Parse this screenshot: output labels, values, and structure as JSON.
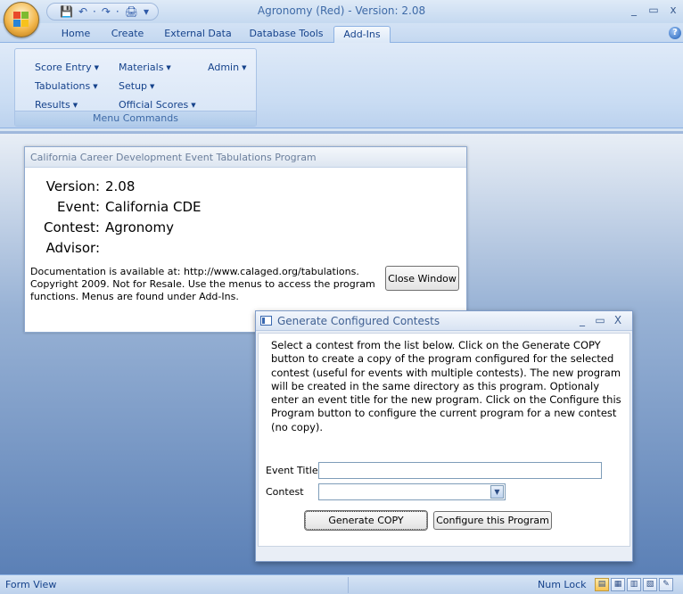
{
  "window": {
    "title": "Agronomy (Red) - Version: 2.08",
    "controls": [
      "_",
      "▭",
      "x"
    ]
  },
  "quick_access": {
    "icons": [
      "save-icon",
      "undo-icon",
      "redo-icon",
      "print-icon",
      "customize-icon"
    ],
    "glyphs": [
      "💾",
      "↶",
      "·",
      "↷",
      "·",
      "🖨",
      "▾"
    ]
  },
  "tabs": [
    {
      "label": "Home",
      "active": false
    },
    {
      "label": "Create",
      "active": false
    },
    {
      "label": "External Data",
      "active": false
    },
    {
      "label": "Database Tools",
      "active": false
    },
    {
      "label": "Add-Ins",
      "active": true
    }
  ],
  "help_glyph": "?",
  "ribbon": {
    "group_label": "Menu Commands",
    "commands": [
      {
        "label": "Score Entry"
      },
      {
        "label": "Materials"
      },
      {
        "label": "Admin"
      },
      {
        "label": "Tabulations"
      },
      {
        "label": "Setup"
      },
      {
        "label": "Results"
      },
      {
        "label": "Official Scores"
      }
    ]
  },
  "main_form": {
    "title": "California Career Development Event Tabulations Program",
    "version_label": "Version:",
    "version_value": "2.08",
    "event_label": "Event:",
    "event_value": "California CDE",
    "contest_label": "Contest:",
    "contest_value": "Agronomy",
    "advisor_label": "Advisor:",
    "advisor_value": "",
    "documentation": "Documentation is available at: http://www.calaged.org/tabulations. Copyright 2009. Not for Resale. Use the menus to access the program functions.   Menus are found under Add-Ins.",
    "close_button": "Close Window"
  },
  "dialog": {
    "title": "Generate Configured Contests",
    "controls": [
      "_",
      "▭",
      "X"
    ],
    "instructions": "Select a contest from the list below.  Click on the Generate COPY button to create a copy of the program configured for the selected contest (useful for events with multiple contests). The new program will be created in the same directory as this program.  Optionaly enter an event title for the new program. Click on the Configure this Program button to configure the current program for a new contest (no copy).",
    "event_title_label": "Event Title",
    "event_title_value": "",
    "contest_label": "Contest",
    "contest_value": "",
    "generate_button": "Generate COPY",
    "configure_button": "Configure this Program"
  },
  "statusbar": {
    "left": "Form View",
    "numlock": "Num Lock"
  },
  "colors": {
    "ribbon_text": "#15428b",
    "workspace_top": "#e8eef6",
    "workspace_bottom": "#5b80b6",
    "office_orb": "#f2b64b"
  }
}
